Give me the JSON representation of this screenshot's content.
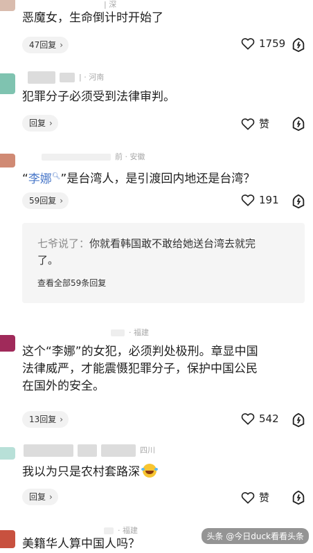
{
  "comments": [
    {
      "meta": "| 深",
      "text": "恶魔女，生命倒计时开始了",
      "reply_label": "47回复",
      "like_count": "1759"
    },
    {
      "meta": "| · 河南",
      "text": "犯罪分子必须受到法律审判。",
      "reply_label": "回复",
      "like_count": "赞"
    },
    {
      "meta": "前 · 安徽",
      "text_open_quote": "“",
      "mention": "李娜",
      "mention_icon": "search-icon",
      "text_rest": "”是台湾人，是引渡回内地还是台湾？",
      "reply_label": "59回复",
      "like_count": "191",
      "quoted_reply": {
        "author": "七爷说了：",
        "text_line1": "你就看韩国敢不敢给她送台湾去就完",
        "text_line2": "了。",
        "view_all": "查看全部59条回复"
      }
    },
    {
      "meta": "· 福建",
      "text_line1": "这个“李娜”的女犯，必须判处极刑。章显中国",
      "text_line2": "法律威严，才能震慑犯罪分子，保护中国公民",
      "text_line3": "在国外的安全。",
      "reply_label": "13回复",
      "like_count": "542"
    },
    {
      "meta": "四川",
      "text": "我以为只是农村套路深",
      "emoji": "laughing-crying-emoji",
      "reply_label": "回复",
      "like_count": "赞"
    },
    {
      "meta": "· 福建",
      "text": "美籍华人算中国人吗？"
    }
  ],
  "watermark": "头条 @今日duck看看头条",
  "colors": {
    "mention": "#4a78c9",
    "avatar_1": "#d9bcae",
    "avatar_2": "#7fc3b0",
    "avatar_3": "#d08a74",
    "avatar_4": "#a02a5a",
    "avatar_5": "#b8e0d8",
    "avatar_6": "#c8513f"
  }
}
